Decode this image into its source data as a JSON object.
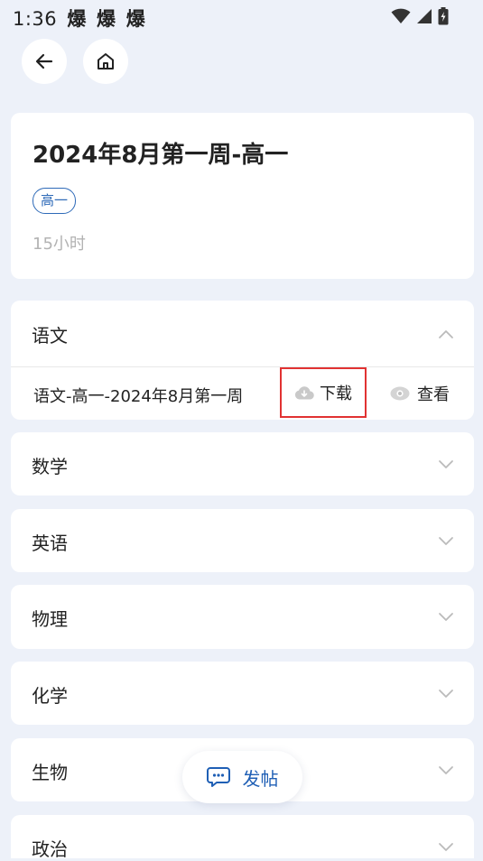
{
  "status_bar": {
    "time": "1:36",
    "notifications": [
      "爆",
      "爆",
      "爆"
    ]
  },
  "nav": {
    "back_icon": "arrow-left-icon",
    "home_icon": "home-icon"
  },
  "info": {
    "title": "2024年8月第一周-高一",
    "tag": "高一",
    "hours": "15小时"
  },
  "subjects": [
    {
      "name": "语文",
      "expanded": true,
      "files": [
        {
          "name": "语文-高一-2024年8月第一周",
          "download_label": "下载",
          "view_label": "查看"
        }
      ]
    },
    {
      "name": "数学",
      "expanded": false
    },
    {
      "name": "英语",
      "expanded": false
    },
    {
      "name": "物理",
      "expanded": false
    },
    {
      "name": "化学",
      "expanded": false
    },
    {
      "name": "生物",
      "expanded": false
    },
    {
      "name": "政治",
      "expanded": false
    }
  ],
  "fab": {
    "label": "发帖",
    "icon": "chat-icon"
  },
  "colors": {
    "background": "#edf1f9",
    "accent": "#1f5fb5",
    "tag": "#2e6ab8",
    "highlight_border": "#e13232"
  }
}
